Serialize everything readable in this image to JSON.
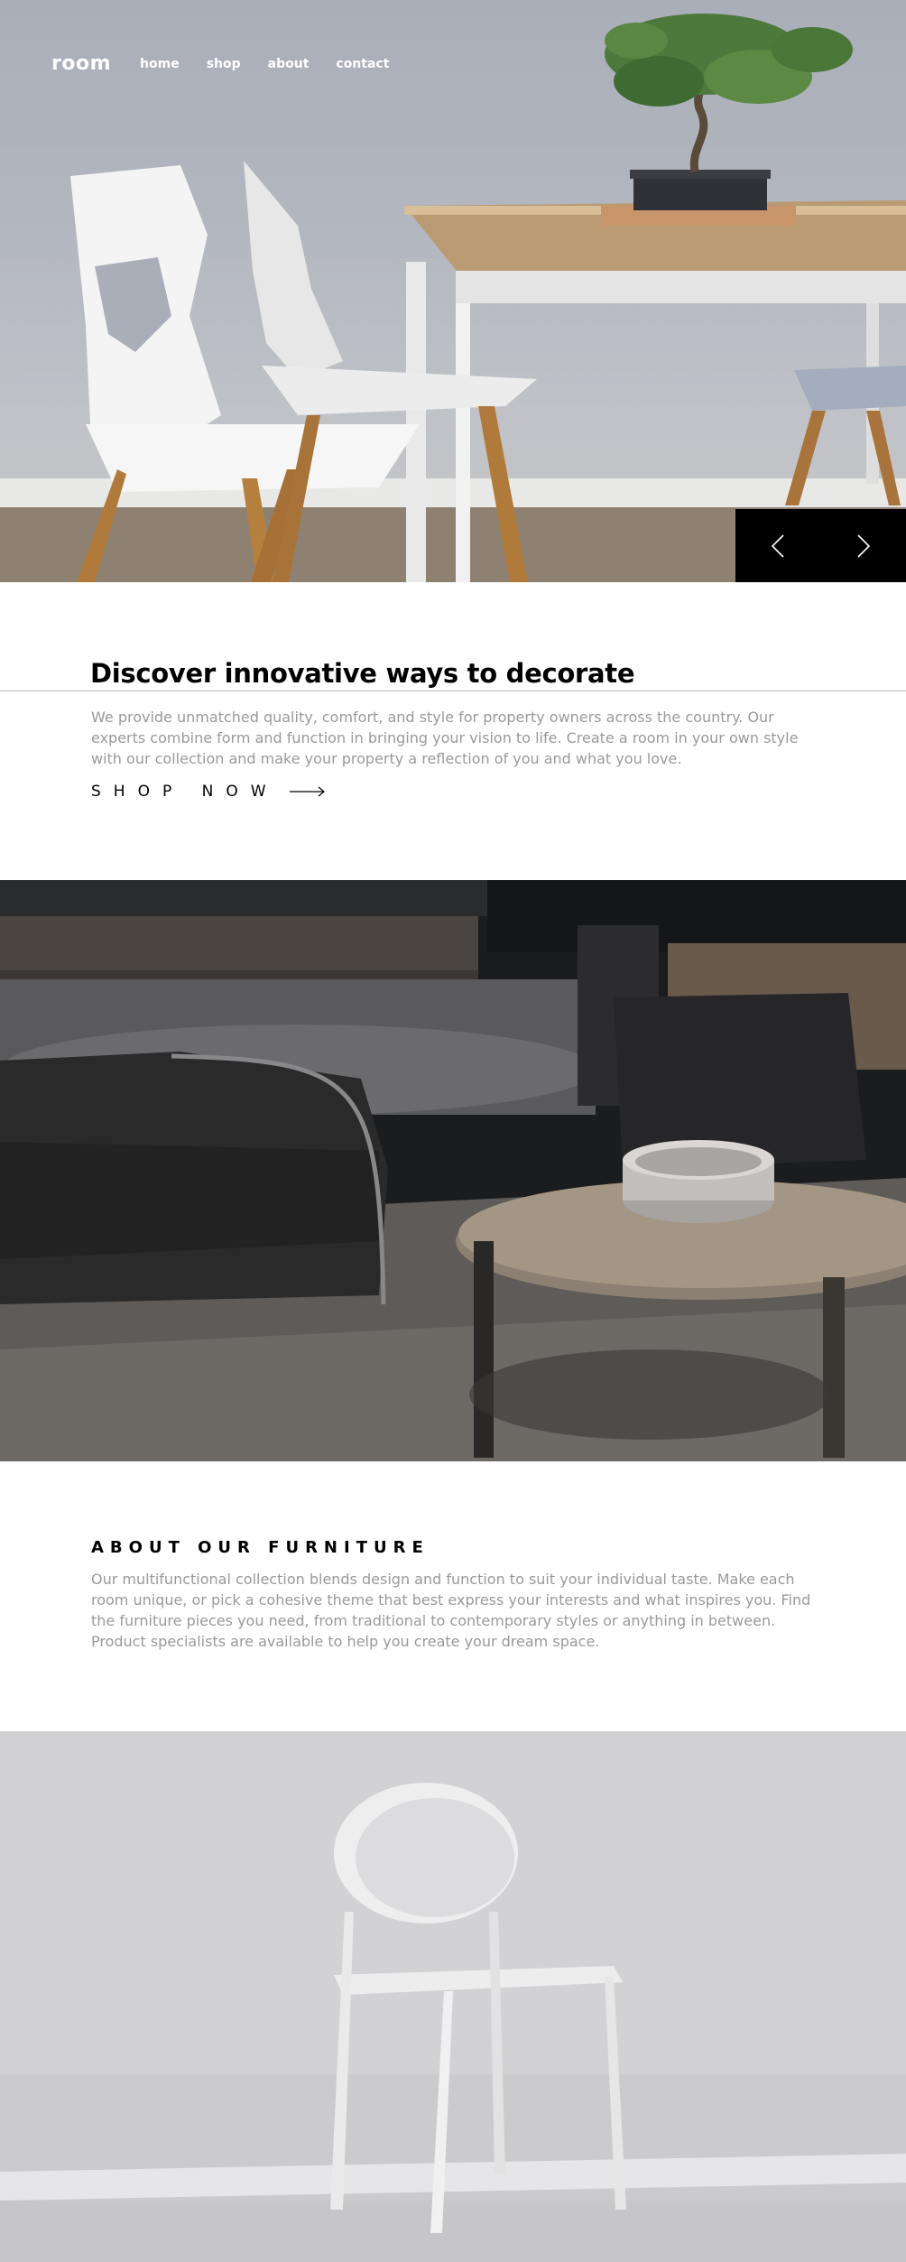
{
  "header": {
    "logo": "room",
    "nav": [
      {
        "label": "home"
      },
      {
        "label": "shop"
      },
      {
        "label": "about"
      },
      {
        "label": "contact"
      }
    ]
  },
  "hero": {
    "image": "white-chairs-and-wooden-table-with-bonsai",
    "prev_icon": "chevron-left-icon",
    "next_icon": "chevron-right-icon"
  },
  "intro": {
    "title": "Discover innovative ways to decorate",
    "text": "We provide unmatched quality, comfort, and style for property owners across the country. Our experts combine form and function in bringing your vision to life. Create a room in your own style with our collection and make your property a reflection of you and what you love.",
    "cta_label": "SHOP NOW",
    "cta_icon": "arrow-right-icon"
  },
  "dark_section": {
    "image": "dark-living-room-armchairs-and-round-table"
  },
  "about": {
    "title": "ABOUT OUR FURNITURE",
    "text": "Our multifunctional collection blends design and function to suit your individual taste. Make each room unique, or pick a cohesive theme that best express your interests and what inspires you. Find the furniture pieces you need, from traditional to contemporary styles or anything in between. Product specialists are available to help you create your dream space."
  },
  "light_section": {
    "image": "white-chair-on-light-grey-background"
  },
  "colors": {
    "text_dark": "#000000",
    "text_muted": "#9a9a9a",
    "nav_text": "#ffffff",
    "slider_bg": "#000000"
  }
}
